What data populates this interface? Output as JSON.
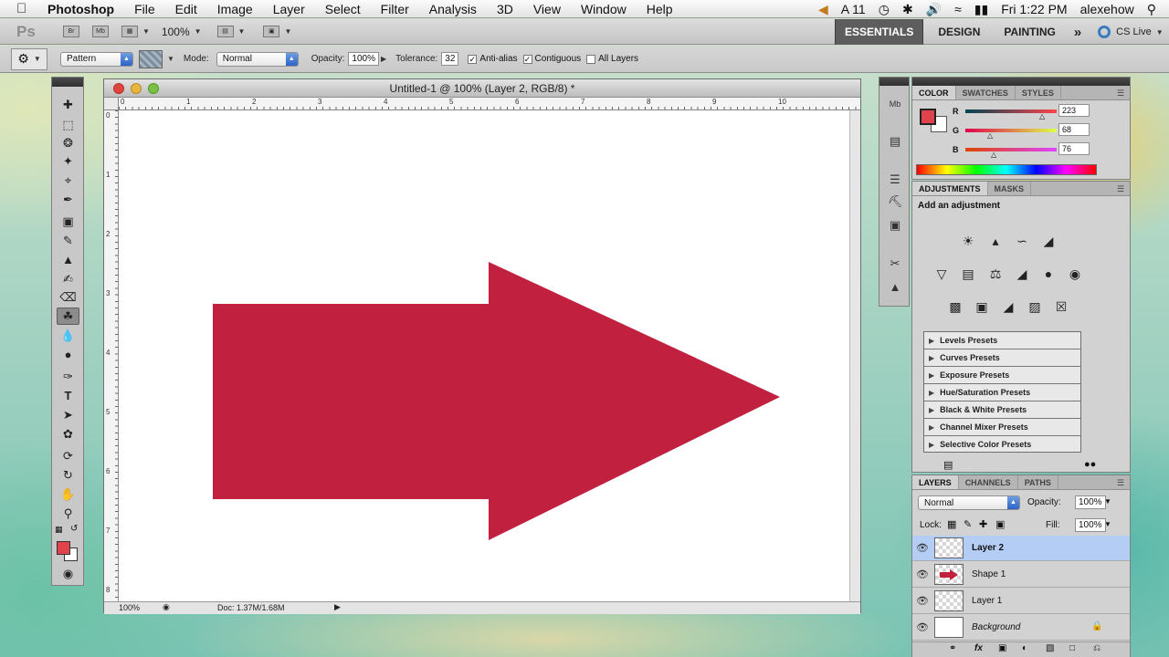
{
  "menubar": {
    "app": "Photoshop",
    "items": [
      "File",
      "Edit",
      "Image",
      "Layer",
      "Select",
      "Filter",
      "Analysis",
      "3D",
      "View",
      "Window",
      "Help"
    ],
    "status": {
      "font_indicator": "A 11",
      "clock": "Fri 1:22 PM",
      "user": "alexehow"
    }
  },
  "appbar": {
    "logo": "Ps",
    "zoom": "100%",
    "workspaces": [
      "ESSENTIALS",
      "DESIGN",
      "PAINTING"
    ],
    "more": "»",
    "cslive": "CS Live"
  },
  "options": {
    "fill_source": "Pattern",
    "mode_label": "Mode:",
    "mode_value": "Normal",
    "opacity_label": "Opacity:",
    "opacity_value": "100%",
    "tolerance_label": "Tolerance:",
    "tolerance_value": "32",
    "antialias_label": "Anti-alias",
    "antialias_checked": true,
    "contiguous_label": "Contiguous",
    "contiguous_checked": true,
    "alllayers_label": "All Layers",
    "alllayers_checked": false
  },
  "document": {
    "title": "Untitled-1 @ 100% (Layer 2, RGB/8) *",
    "zoom": "100%",
    "doc_info": "Doc: 1.37M/1.68M",
    "ruler_top": [
      "0",
      "1",
      "2",
      "3",
      "4",
      "5",
      "6",
      "7",
      "8",
      "9",
      "10"
    ],
    "ruler_left": [
      "0",
      "1",
      "2",
      "3",
      "4",
      "5",
      "6",
      "7",
      "8"
    ],
    "shape_color": "#c1203f"
  },
  "color_panel": {
    "tabs": [
      "COLOR",
      "SWATCHES",
      "STYLES"
    ],
    "r_label": "R",
    "r": "223",
    "g_label": "G",
    "g": "68",
    "b_label": "B",
    "b": "76",
    "fg_color": "#df444c"
  },
  "adjustments_panel": {
    "tabs": [
      "ADJUSTMENTS",
      "MASKS"
    ],
    "heading": "Add an adjustment",
    "presets": [
      "Levels Presets",
      "Curves Presets",
      "Exposure Presets",
      "Hue/Saturation Presets",
      "Black & White Presets",
      "Channel Mixer Presets",
      "Selective Color Presets"
    ]
  },
  "layers_panel": {
    "tabs": [
      "LAYERS",
      "CHANNELS",
      "PATHS"
    ],
    "blend_mode": "Normal",
    "opacity_label": "Opacity:",
    "opacity": "100%",
    "lock_label": "Lock:",
    "fill_label": "Fill:",
    "fill": "100%",
    "layers": [
      "Layer 2",
      "Shape 1",
      "Layer 1",
      "Background"
    ],
    "selected": "Layer 2"
  }
}
